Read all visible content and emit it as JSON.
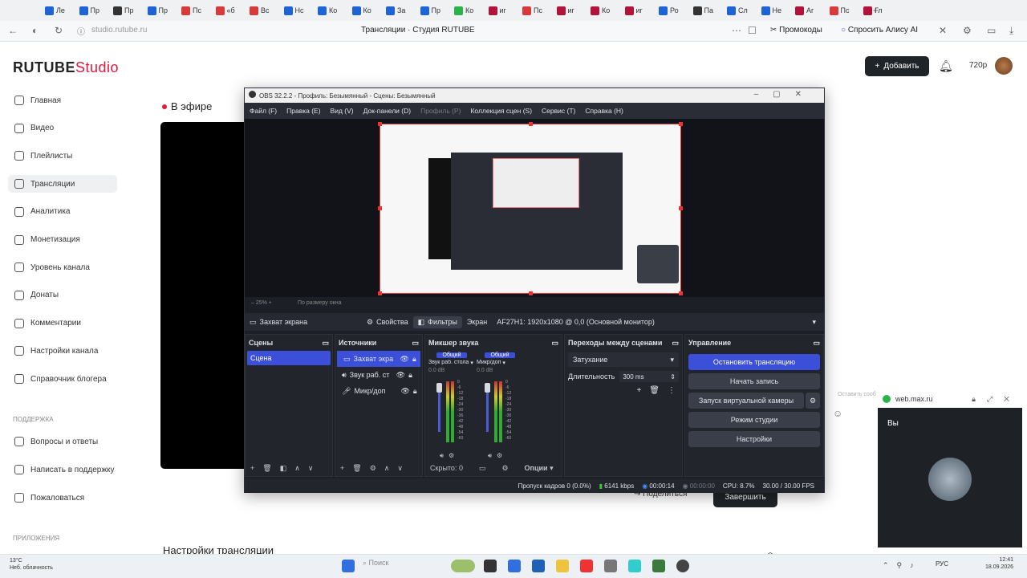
{
  "browser": {
    "tabs": [
      {
        "label": "Ле",
        "color": "#1e63d6"
      },
      {
        "label": "Пр",
        "color": "#1e63d6"
      },
      {
        "label": "Пр",
        "color": "#333333"
      },
      {
        "label": "Пр",
        "color": "#1e63d6"
      },
      {
        "label": "Пс",
        "color": "#d83a3a"
      },
      {
        "label": "«б",
        "color": "#d83a3a"
      },
      {
        "label": "Вс",
        "color": "#d83a3a"
      },
      {
        "label": "Нс",
        "color": "#1e63d6"
      },
      {
        "label": "Ко",
        "color": "#1e63d6"
      },
      {
        "label": "Ко",
        "color": "#1e63d6"
      },
      {
        "label": "За",
        "color": "#1e63d6"
      },
      {
        "label": "Пр",
        "color": "#1e63d6"
      },
      {
        "label": "Ко",
        "color": "#2bb34a"
      },
      {
        "label": "иг",
        "color": "#b3123a"
      },
      {
        "label": "Пс",
        "color": "#d83a3a"
      },
      {
        "label": "иг",
        "color": "#b3123a"
      },
      {
        "label": "Ко",
        "color": "#b3123a"
      },
      {
        "label": "иг",
        "color": "#b3123a"
      },
      {
        "label": "Ро",
        "color": "#1e63d6"
      },
      {
        "label": "Па",
        "color": "#333333"
      },
      {
        "label": "Сл",
        "color": "#1e63d6"
      },
      {
        "label": "Не",
        "color": "#1e63d6"
      },
      {
        "label": "Аг",
        "color": "#b3123a"
      },
      {
        "label": "Пс",
        "color": "#d83a3a"
      },
      {
        "label": "Гл",
        "color": "#b3123a"
      }
    ],
    "new_tab": "+",
    "url": "studio.rutube.ru",
    "page_title": "Трансляции · Студия RUTUBE",
    "promo": "Промокоды",
    "alice": "Спросить Алису AI"
  },
  "rutube": {
    "logo_main": "RUTUBE",
    "logo_studio": "Studio",
    "add_button": "Добавить",
    "quality": "720p",
    "on_air": "В эфире",
    "nav": [
      "Главная",
      "Видео",
      "Плейлисты",
      "Трансляции",
      "Аналитика",
      "Монетизация",
      "Уровень канала",
      "Донаты",
      "Комментарии",
      "Настройки канала",
      "Справочник блогера"
    ],
    "support_title": "ПОДДЕРЖКА",
    "support": [
      "Вопросы и ответы",
      "Написать в поддержку",
      "Пожаловаться"
    ],
    "apps_title": "ПРИЛОЖЕНИЯ",
    "share": "Поделиться",
    "finish": "Завершить",
    "settings_title": "Настройки трансляции",
    "leave_text": "Оставить сооб"
  },
  "obs": {
    "title": "OBS 32.2.2 - Профиль: Безымянный - Сцены: Безымянный",
    "menu": [
      "Файл (F)",
      "Правка (E)",
      "Вид (V)",
      "Док-панели (D)",
      "Профиль (P)",
      "Коллекция сцен (S)",
      "Сервис (T)",
      "Справка (H)"
    ],
    "zoom": "25%",
    "zoom_text": "По размеру окна",
    "source_name": "Захват экрана",
    "properties": "Свойства",
    "filters": "Фильтры",
    "screen_label": "Экран",
    "screen_value": "AF27H1: 1920x1080 @ 0,0 (Основной монитор)",
    "scenes_title": "Сцены",
    "scenes": [
      "Сцена"
    ],
    "sources_title": "Источники",
    "sources": [
      "Захват экра",
      "Звук раб. ст",
      "Микр/доп"
    ],
    "mixer_title": "Микшер звука",
    "mixer_channels": [
      {
        "tag": "Общий",
        "name": "Звук раб. стола",
        "db": "0.0 dB",
        "level": 0.75
      },
      {
        "tag": "Общий",
        "name": "Микр/доп",
        "db": "0.0 dB",
        "level": 0.75
      }
    ],
    "db_ticks": [
      "0",
      "-6",
      "-12",
      "-18",
      "-24",
      "-30",
      "-36",
      "-42",
      "-48",
      "-54",
      "-60"
    ],
    "hidden": "Скрыто: 0",
    "options": "Опции",
    "transitions_title": "Переходы между сценами",
    "transition": "Затухание",
    "duration_label": "Длительность",
    "duration_value": "300 ms",
    "controls_title": "Управление",
    "controls": [
      "Остановить трансляцию",
      "Начать запись",
      "Запуск виртуальной камеры",
      "Режим студии",
      "Настройки"
    ],
    "status": {
      "dropped": "Пропуск кадров 0 (0.0%)",
      "bitrate": "6141 kbps",
      "stream_time": "00:00:14",
      "rec_time": "00:00:00",
      "cpu": "CPU: 8.7%",
      "fps": "30.00 / 30.00 FPS"
    }
  },
  "max_popup": {
    "site": "web.max.ru",
    "you": "Вы"
  },
  "taskbar": {
    "weather_temp": "13°C",
    "weather_desc": "Неб. облачность",
    "search": "Поиск",
    "lang": "РУС",
    "time": "12:41",
    "date": "18.09.2026"
  }
}
